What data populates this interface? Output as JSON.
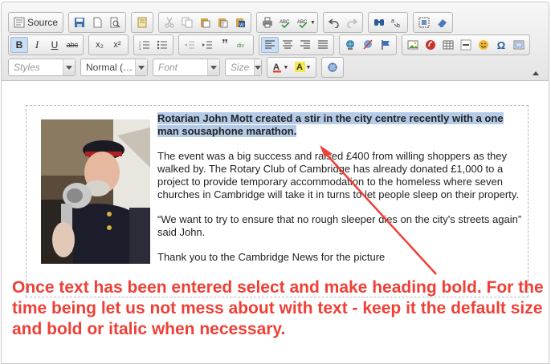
{
  "toolbar": {
    "source_label": "Source",
    "icons_row1": [
      "save-icon",
      "new-page-icon",
      "preview-icon",
      "templates-icon",
      "cut-icon",
      "copy-icon",
      "paste-icon",
      "paste-text-icon",
      "paste-word-icon",
      "print-icon",
      "spellcheck-icon",
      "spellcheck-as-you-type-icon",
      "undo-icon",
      "redo-icon",
      "find-icon",
      "replace-icon",
      "select-all-icon",
      "remove-format-icon"
    ],
    "bold_label": "B",
    "italic_label": "I",
    "underline_label": "U",
    "strike_label": "abc",
    "subscript_label": "x₂",
    "superscript_label": "x²",
    "styles_placeholder": "Styles",
    "format_value": "Normal (…",
    "font_placeholder": "Font",
    "size_placeholder": "Size"
  },
  "article": {
    "heading": "Rotarian John Mott created a stir in the city centre recently with a one man sousaphone marathon.",
    "paragraph1": "The event was a big success and raised £400 from  willing shoppers as they walked by. The Rotary Club of Cambridge has already donated £1,000 to a project to provide temporary accommodation to the homeless where seven churches in Cambridge will take it in turns to let people sleep on their property.",
    "paragraph2": "“We want to try to ensure that no rough sleeper dies on the city's streets again”  said John.",
    "paragraph3": "Thank you to the Cambridge News for the picture"
  },
  "annotation": {
    "text": "Once text has been entered select and make heading bold. For the time being let us not mess about with text - keep it the default size and bold or italic when necessary.",
    "color": "#ee4036"
  },
  "colors": {
    "selection": "#b4cbe8",
    "active_button": "#c9ddf3"
  }
}
